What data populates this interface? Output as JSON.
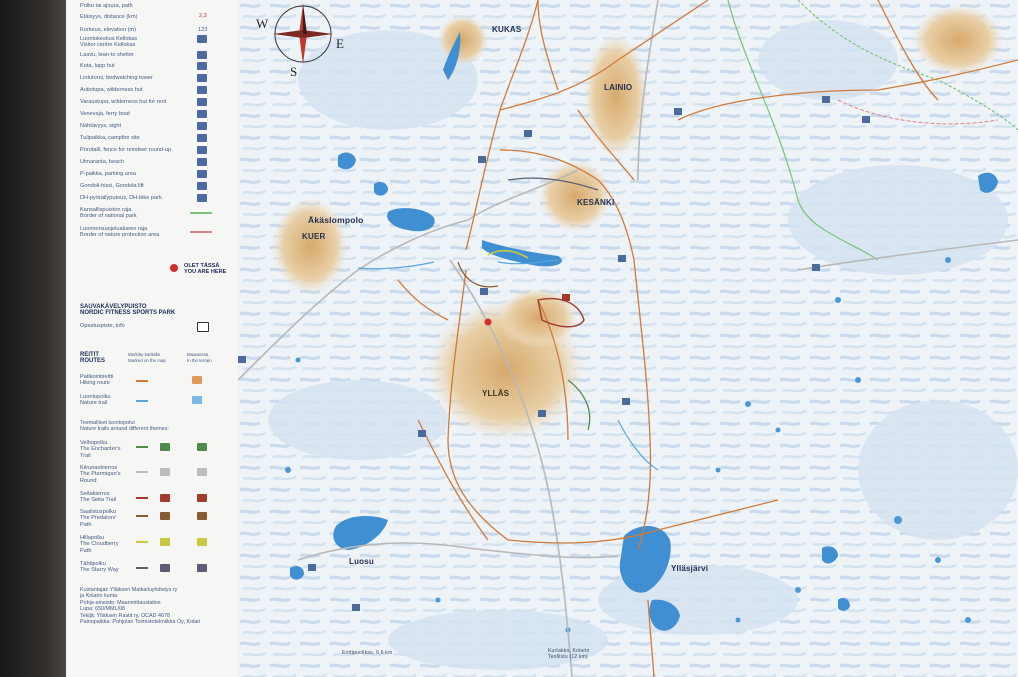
{
  "legend": {
    "rows": [
      "Polku tai ajoura, path",
      "Etäisyys, distance (km)",
      "Korkeus, elevation (m)",
      "Luontokeskus Kellokas\nVisitor centre Kellokas",
      "Laavu, lean-to shelter",
      "Kota, lapp hut",
      "Lintutorni, birdwatching tower",
      "Autiotupa, wilderness hut",
      "Varaustupa, wilderness hut for rent",
      "Venevaja, ferry boat",
      "Nähtävyys, sight",
      "Tulipaikka, campfire site",
      "Porotalli, fence for reindeer round-up",
      "Uimaranta, beach",
      "P-paikka, parking area",
      "Gondoli-hissi, Gondola lift",
      "DH-pyöräilyputous, DH-bike park",
      "Kansallispuiston raja\nBorder of national park",
      "Luonnonsuojelualueen raja\nBorder of nature protection area"
    ],
    "distance_value": "2,3",
    "elevation_value": "123",
    "you_are_here": "OLET TÄSSÄ\nYOU ARE HERE",
    "park_title": "SAUVAKÄVELYPUISTO\nNORDIC FITNESS SPORTS PARK",
    "info_point": "Opastuspiste, info",
    "routes_title": "REITIT\nROUTES",
    "routes_marked_map": "Merkitty karttalla\nMarked on the map",
    "routes_marked_terrain": "Maastossa\nIn the terrain",
    "route_hiking": "Patikointireitti\nHiking route",
    "route_nature": "Luontopolku\nNature trail",
    "themed_title": "Teemalliset luontopolut\nNature trails around different themes:",
    "themed": [
      {
        "label": "Velhopolku\nThe Enchanter's\nTrail",
        "color": "#4f8c4a"
      },
      {
        "label": "Kiirunankierros\nThe Ptarmigan's\nRound",
        "color": "#bdbdbd"
      },
      {
        "label": "Seitakierros\nThe Seita Trail",
        "color": "#a33a2b"
      },
      {
        "label": "Saalistuspolku\nThe Predators'\nPath",
        "color": "#8a5a30"
      },
      {
        "label": "Hillapolku\nThe Cloudberry\nPath",
        "color": "#c8c843"
      },
      {
        "label": "Tähtipolku\nThe Starry Way",
        "color": "#5d5c72"
      }
    ],
    "publisher": "Kustantajat:   Ylläksen Matkailuyhdistys ry\n                  ja Kolarin kunta\nPohja-aineisto: Maanmittauslaitos\nLupa: 650/MML/08\nTekijä: Ylläksen Rastit ry, OCAD 4678\nPainopaikka: Pohjolan Toimistotekniikka Oy, Kolari"
  },
  "compass": {
    "w": "W",
    "e": "E",
    "s": "S"
  },
  "places": {
    "kukas": "KUKAS",
    "lainio": "LAINIO",
    "kesanki": "KESÄNKI",
    "akaslompolo": "Äkäslompolo",
    "kuer": "KUER",
    "yllas": "YLLÄS",
    "luosu": "Luosu",
    "yllasjarvi": "Ylläsjärvi",
    "kolari": "Kurtakko, Kolarin\nTeollistu (12 km)",
    "enttipuoli": "Enttipuolikas, 6,6 km"
  },
  "colors": {
    "water": "#3f8fd2",
    "hill": "#d9b27c",
    "route": "#d07a3a",
    "nature_trail": "#58a6db",
    "park_border": "#7cc27a",
    "protect_border": "#e07f8c",
    "you_are_here": "#d42b2b"
  }
}
